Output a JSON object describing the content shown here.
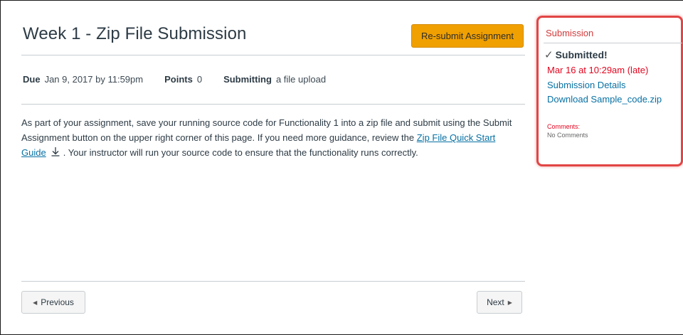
{
  "assignment": {
    "title": "Week 1 - Zip File Submission",
    "resubmit_label": "Re-submit Assignment",
    "due_label": "Due",
    "due_value": "Jan 9, 2017 by 11:59pm",
    "points_label": "Points",
    "points_value": "0",
    "submitting_label": "Submitting",
    "submitting_value": "a file upload",
    "description": {
      "part1": "As part of your assignment, save your running source code for Functionality 1 into a zip file and submit using the Submit Assignment button on the upper right corner of this page. If you need more guidance, review the ",
      "link_text": "Zip File Quick Start Guide",
      "part2": ". Your instructor will run your source code to ensure that the functionality runs correctly."
    }
  },
  "navigation": {
    "previous_label": "Previous",
    "next_label": "Next"
  },
  "submission": {
    "header": "Submission",
    "status": "Submitted!",
    "date": "Mar 16 at 10:29am (late)",
    "details_link": "Submission Details",
    "download_link": "Download Sample_code.zip",
    "comments_label": "Comments:",
    "comments_value": "No Comments"
  },
  "colors": {
    "primary_button": "#f0a000",
    "late_red": "#e0061f",
    "link_blue": "#0770a3",
    "highlight_border": "#e24545"
  },
  "icons": {
    "download": "download-icon",
    "check": "check-icon",
    "prev": "triangle-left-icon",
    "next": "triangle-right-icon"
  }
}
